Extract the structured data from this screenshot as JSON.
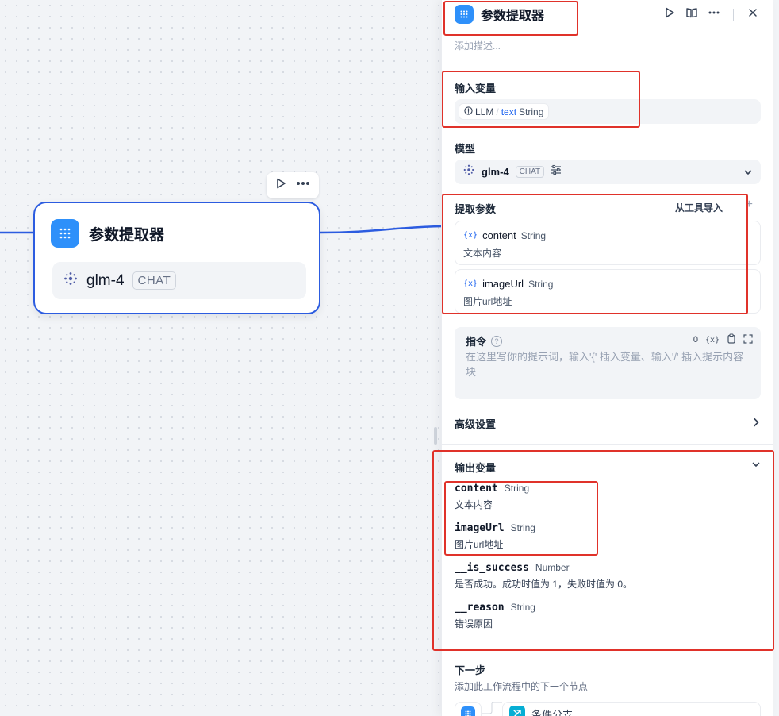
{
  "canvas": {
    "node": {
      "title": "参数提取器",
      "model_name": "glm-4",
      "model_badge": "CHAT"
    }
  },
  "panel": {
    "title": "参数提取器",
    "description_placeholder": "添加描述...",
    "input_section": {
      "label": "输入变量",
      "source_node": "LLM",
      "separator": "/",
      "variable": "text",
      "type": "String"
    },
    "model_section": {
      "label": "模型",
      "model_name": "glm-4",
      "badge": "CHAT"
    },
    "extract_section": {
      "label": "提取参数",
      "import_label": "从工具导入",
      "add_label": "+",
      "params": [
        {
          "icon": "{x}",
          "name": "content",
          "type": "String",
          "description": "文本内容"
        },
        {
          "icon": "{x}",
          "name": "imageUrl",
          "type": "String",
          "description": "图片url地址"
        }
      ]
    },
    "instruction_section": {
      "label": "指令",
      "help": "?",
      "count": "0",
      "var_tool": "{x}",
      "placeholder": "在这里写你的提示词，输入'{' 插入变量、输入'/' 插入提示内容块"
    },
    "advanced": {
      "label": "高级设置"
    },
    "output_section": {
      "label": "输出变量",
      "items": [
        {
          "name": "content",
          "type": "String",
          "description": "文本内容"
        },
        {
          "name": "imageUrl",
          "type": "String",
          "description": "图片url地址"
        },
        {
          "name": "__is_success",
          "type": "Number",
          "description": "是否成功。成功时值为 1，失败时值为 0。"
        },
        {
          "name": "__reason",
          "type": "String",
          "description": "错误原因"
        }
      ]
    },
    "next_step": {
      "label": "下一步",
      "description": "添加此工作流程中的下一个节点",
      "branch_label": "条件分支"
    }
  },
  "colors": {
    "accent": "#2c5ce0",
    "node_icon": "#2e90fa",
    "annotation_red": "#e0322a",
    "branch_icon": "#06aed4"
  },
  "icons": [
    "grid-icon",
    "play-icon",
    "more-icon",
    "book-icon",
    "close-icon",
    "info-icon",
    "model-logo-icon",
    "settings-sliders-icon",
    "chevron-down-icon",
    "chevron-right-icon",
    "variable-icon",
    "copy-icon",
    "expand-icon",
    "help-icon",
    "branch-icon"
  ]
}
